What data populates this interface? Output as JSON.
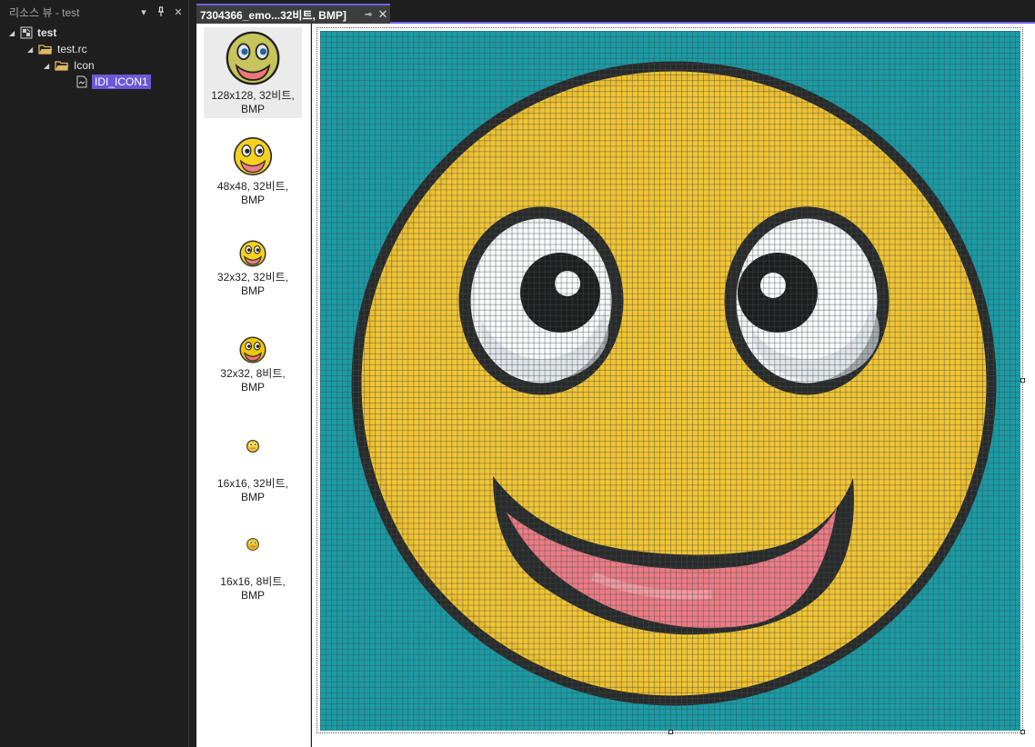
{
  "resource_view": {
    "title": "리소스 뷰 - test",
    "dropdown_icon": "chevron-down-icon",
    "pin_icon": "pin-icon",
    "close_icon": "close-icon",
    "tree": {
      "root_label": "test",
      "rc_label": "test.rc",
      "folder_label": "Icon",
      "item_label": "IDI_ICON1"
    }
  },
  "editor_tab": {
    "title": "7304366_emo...32비트, BMP]",
    "pin_icon": "pin-icon",
    "close_icon": "close-icon"
  },
  "image_types": [
    {
      "line1": "128x128, 32비트,",
      "line2": "BMP",
      "selected": true
    },
    {
      "line1": "48x48, 32비트,",
      "line2": "BMP",
      "selected": false
    },
    {
      "line1": "32x32, 32비트,",
      "line2": "BMP",
      "selected": false
    },
    {
      "line1": "32x32, 8비트,",
      "line2": "BMP",
      "selected": false
    },
    {
      "line1": "16x16, 32비트,",
      "line2": "BMP",
      "selected": false
    },
    {
      "line1": "16x16, 8비트,",
      "line2": "BMP",
      "selected": false
    }
  ],
  "colors": {
    "accent": "#7160e8",
    "selection": "#6b58d6",
    "canvas_background": "#1a9ba5",
    "face_yellow": "#f3c431",
    "outline": "#2a2a2a",
    "mouth_pink": "#ef7d86"
  }
}
